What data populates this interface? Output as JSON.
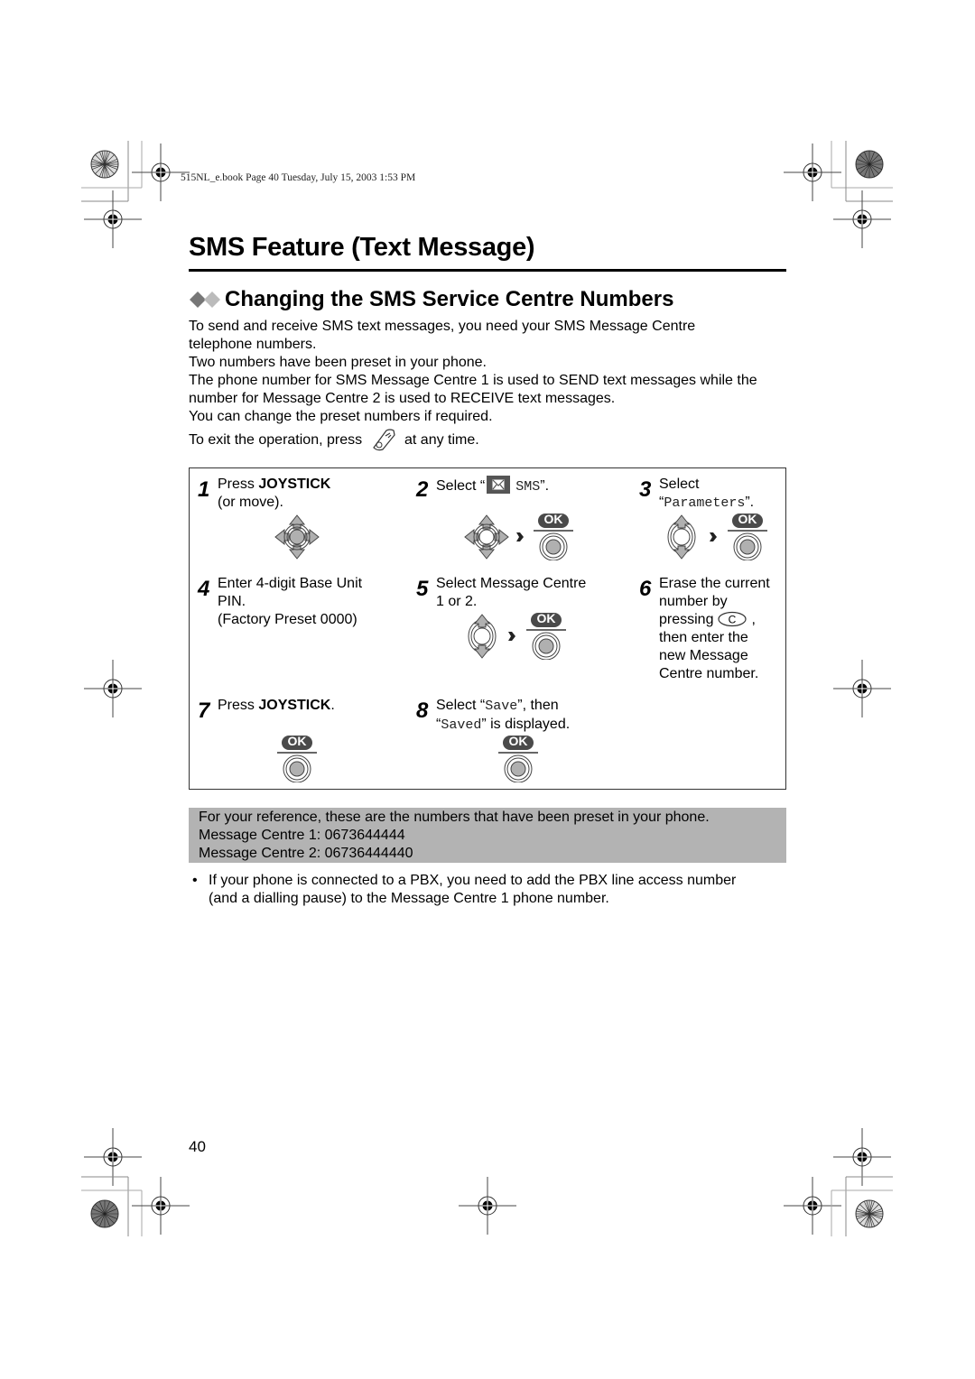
{
  "header": {
    "print_info": "515NL_e.book  Page 40  Tuesday, July 15, 2003  1:53 PM"
  },
  "page": {
    "title": "SMS Feature (Text Message)",
    "section_title": "Changing the SMS Service Centre Numbers",
    "page_number": "40"
  },
  "intro": {
    "lines": [
      "To send and receive SMS text messages, you need your SMS Message Centre telephone numbers.",
      "Two numbers have been preset in your phone.",
      "The phone number for SMS Message Centre 1 is used to SEND text messages while the number for Message Centre 2 is used to RECEIVE text messages.",
      "You can change the preset numbers if required."
    ],
    "exit_before": "To exit the operation, press",
    "exit_after": "at any time.",
    "exit_icon": "off-hook-key-icon"
  },
  "steps": [
    {
      "num": "1",
      "line1_pre": "Press ",
      "line1_bold": "JOYSTICK",
      "line2": "(or move).",
      "icons": [
        "joystick-4way-icon"
      ]
    },
    {
      "num": "2",
      "pre": "Select “",
      "mono": "SMS",
      "post": "”.",
      "inline_icon": "sms-envelope-icon",
      "icons": [
        "joystick-4way-icon",
        "arrow-right-icon",
        "ok-label",
        "joystick-press-icon"
      ]
    },
    {
      "num": "3",
      "line1": "Select",
      "mono": "Parameters",
      "icons": [
        "joystick-updown-icon",
        "arrow-right-icon",
        "ok-label",
        "joystick-press-icon"
      ]
    },
    {
      "num": "4",
      "line1": "Enter 4-digit Base Unit",
      "line2": "PIN.",
      "line3": "(Factory Preset 0000)"
    },
    {
      "num": "5",
      "line1": "Select Message Centre",
      "line2": "1 or 2.",
      "icons": [
        "joystick-updown-icon",
        "arrow-right-icon",
        "ok-label",
        "joystick-press-icon"
      ]
    },
    {
      "num": "6",
      "line1": "Erase the current",
      "line2": "number by",
      "line3_pre": "pressing",
      "line3_key": "C",
      "line3_post": ",",
      "line4": "then enter the",
      "line5": "new Message",
      "line6": "Centre number."
    },
    {
      "num": "7",
      "line1_pre": "Press ",
      "line1_bold": "JOYSTICK",
      "line1_post": ".",
      "icons": [
        "ok-label",
        "joystick-press-icon"
      ]
    },
    {
      "num": "8",
      "line1_pre": "Select “",
      "line1_mono": "Save",
      "line1_post": "”, then",
      "line2_pre": "“",
      "line2_mono": "Saved",
      "line2_post": "” is displayed.",
      "icons": [
        "ok-label",
        "joystick-press-icon"
      ]
    }
  ],
  "ok_label": "OK",
  "reference": {
    "intro": "For your reference, these are the numbers that have been preset in your phone.",
    "centre1": "Message Centre 1: 0673644444",
    "centre2": "Message Centre 2: 06736444440"
  },
  "notes": [
    {
      "line1": "If your phone is connected to a PBX, you need to add the PBX line access number",
      "line2": "(and a dialling pause) to the Message Centre 1 phone number."
    }
  ],
  "colors": {
    "reference_bg": "#b3b3b3",
    "ok_badge": "#4a4a4a",
    "joystick_gray": "#b0b0b0"
  }
}
